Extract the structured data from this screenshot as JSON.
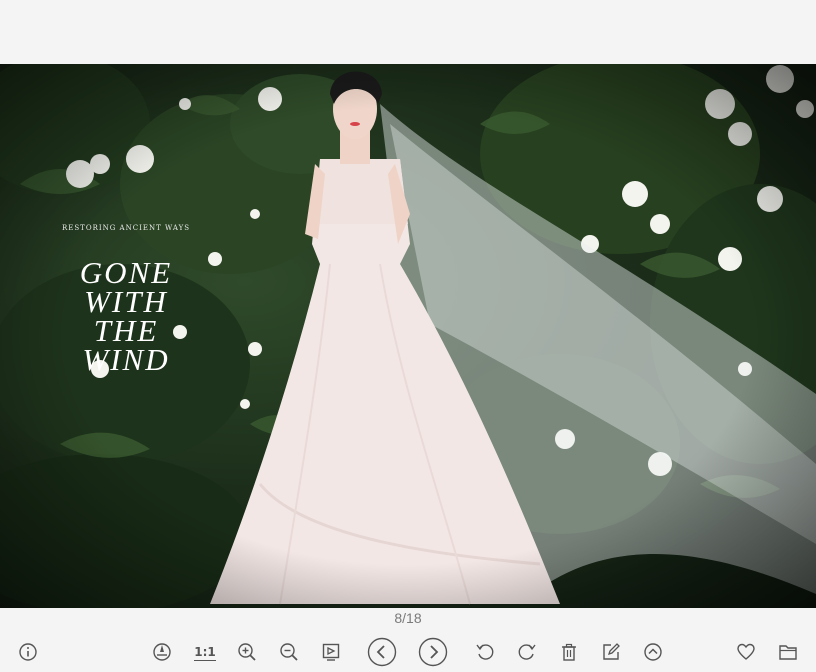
{
  "window": {
    "background": "#f4f4f4"
  },
  "photo": {
    "overlay_small_text": "RESTORING ANCIENT WAYS",
    "overlay_title_lines": [
      "GONE",
      "WITH",
      "THE",
      "WIND"
    ]
  },
  "counter": {
    "text": "8/18",
    "current": 8,
    "total": 18
  },
  "toolbar": {
    "icon_color": "#555555",
    "buttons": [
      {
        "name": "info-icon"
      },
      {
        "name": "compass-icon"
      },
      {
        "name": "actual-size-icon",
        "label": "1:1"
      },
      {
        "name": "zoom-in-icon"
      },
      {
        "name": "zoom-out-icon"
      },
      {
        "name": "fit-to-window-icon"
      },
      {
        "name": "previous-icon"
      },
      {
        "name": "next-icon"
      },
      {
        "name": "rotate-left-icon"
      },
      {
        "name": "rotate-right-icon"
      },
      {
        "name": "delete-icon"
      },
      {
        "name": "edit-icon"
      },
      {
        "name": "upload-icon"
      },
      {
        "name": "favorite-icon"
      },
      {
        "name": "folder-icon"
      }
    ]
  }
}
